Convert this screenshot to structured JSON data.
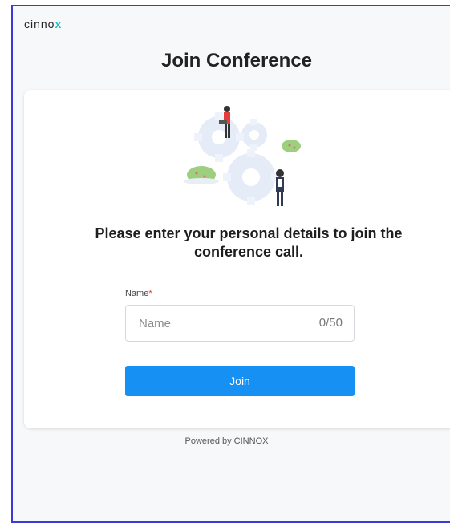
{
  "header": {
    "logo": {
      "main": "CINNO",
      "accent": "X"
    },
    "title": "Join Conference"
  },
  "card": {
    "illustration_icon": "gears-people-illustration",
    "prompt": "Please enter your personal details to join the conference call.",
    "name_field": {
      "label": "Name",
      "required_mark": "*",
      "placeholder": "Name",
      "value": "",
      "counter": "0/50"
    },
    "join_label": "Join"
  },
  "footer": {
    "powered_by": "Powered by CINNOX"
  },
  "colors": {
    "accent": "#1690f2",
    "logo_accent": "#18c2c8",
    "required": "#e0352b"
  }
}
